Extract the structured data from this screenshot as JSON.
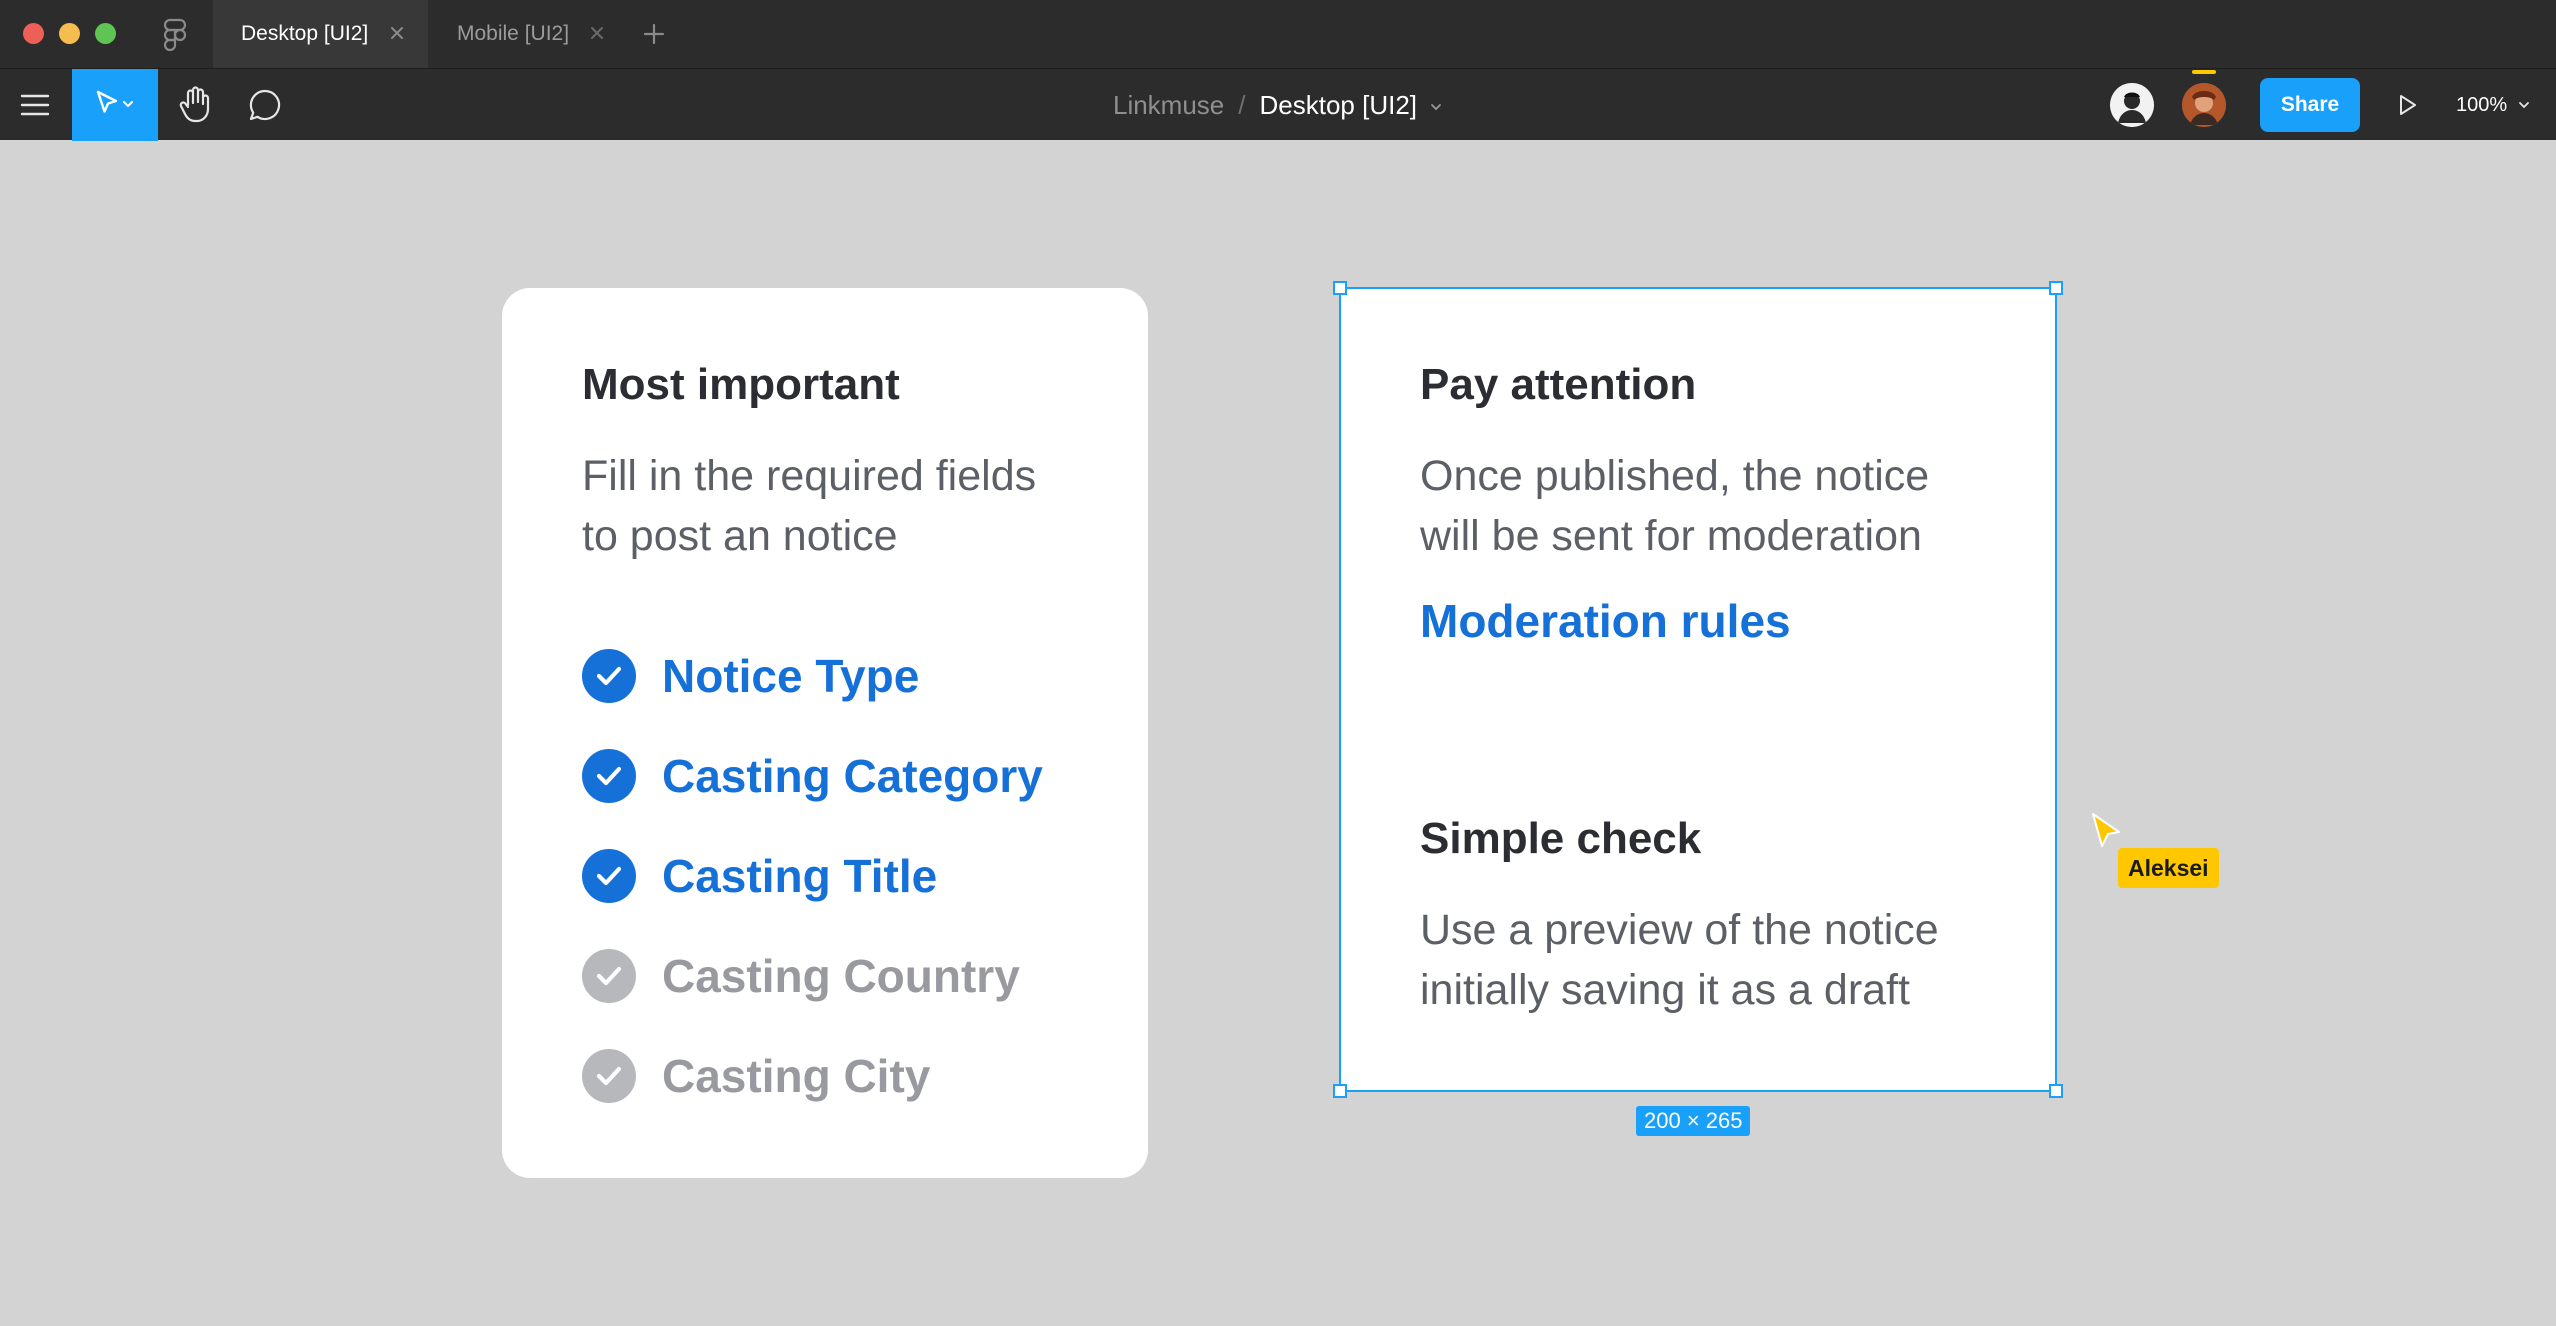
{
  "window": {
    "tabs": [
      {
        "label": "Desktop [UI2]",
        "active": true
      },
      {
        "label": "Mobile [UI2]",
        "active": false
      }
    ],
    "new_tab_icon": "plus-icon"
  },
  "toolbar": {
    "tools": [
      "menu-icon",
      "move-tool-icon",
      "hand-tool-icon",
      "comment-icon"
    ],
    "breadcrumb": {
      "project": "Linkmuse",
      "separator": "/",
      "file": "Desktop [UI2]"
    },
    "share_label": "Share",
    "zoom_label": "100%"
  },
  "canvas": {
    "left_card": {
      "title": "Most important",
      "description_line1": "Fill in the required fields",
      "description_line2": "to post an notice",
      "checklist": [
        {
          "label": "Notice Type",
          "done": true
        },
        {
          "label": "Casting Category",
          "done": true
        },
        {
          "label": "Casting Title",
          "done": true
        },
        {
          "label": "Casting Country",
          "done": false
        },
        {
          "label": "Casting City",
          "done": false
        }
      ]
    },
    "right_card": {
      "section1_title": "Pay attention",
      "section1_line1": "Once published, the notice",
      "section1_line2": "will be sent for moderation",
      "link_label": "Moderation rules",
      "section2_title": "Simple check",
      "section2_line1": "Use a preview of the notice",
      "section2_line2": "initially saving it as a draft"
    },
    "selection_size_label": "200 × 265",
    "collaborator": {
      "name": "Aleksei"
    }
  },
  "colors": {
    "accent": "#18a0fb",
    "link_blue": "#1570d8",
    "canvas_bg": "#d3d3d3",
    "chrome_bg": "#2c2c2c",
    "cursor_yellow": "#ffc700"
  }
}
